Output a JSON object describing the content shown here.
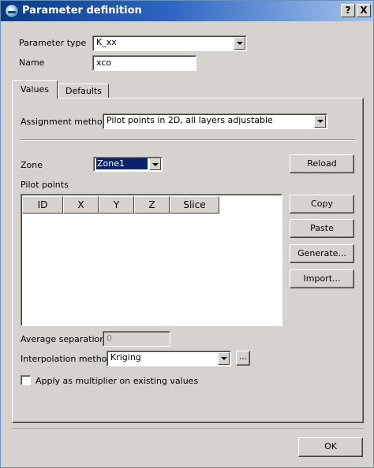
{
  "window": {
    "title": "Parameter definition",
    "help_label": "?",
    "close_label": "X"
  },
  "parameter_type": {
    "label": "Parameter type",
    "value": "K_xx"
  },
  "name": {
    "label": "Name",
    "value": "xco"
  },
  "tabs": [
    {
      "label": "Values",
      "active": true
    },
    {
      "label": "Defaults",
      "active": false
    }
  ],
  "assignment_method": {
    "label": "Assignment method",
    "value": "Pilot points in 2D, all layers adjustable"
  },
  "zone": {
    "label": "Zone",
    "value": "Zone1"
  },
  "pilot_points": {
    "label": "Pilot points",
    "columns": [
      "ID",
      "X",
      "Y",
      "Z",
      "Slice"
    ],
    "rows": []
  },
  "buttons": {
    "reload": "Reload",
    "copy": "Copy",
    "paste": "Paste",
    "generate": "Generate...",
    "import": "Import...",
    "ellipsis": "...",
    "ok": "OK"
  },
  "average_separation": {
    "label": "Average separation",
    "value": "0"
  },
  "interpolation_method": {
    "label": "Interpolation method",
    "value": "Kriging"
  },
  "apply_multiplier": {
    "label": "Apply as multiplier on existing values",
    "checked": false
  }
}
